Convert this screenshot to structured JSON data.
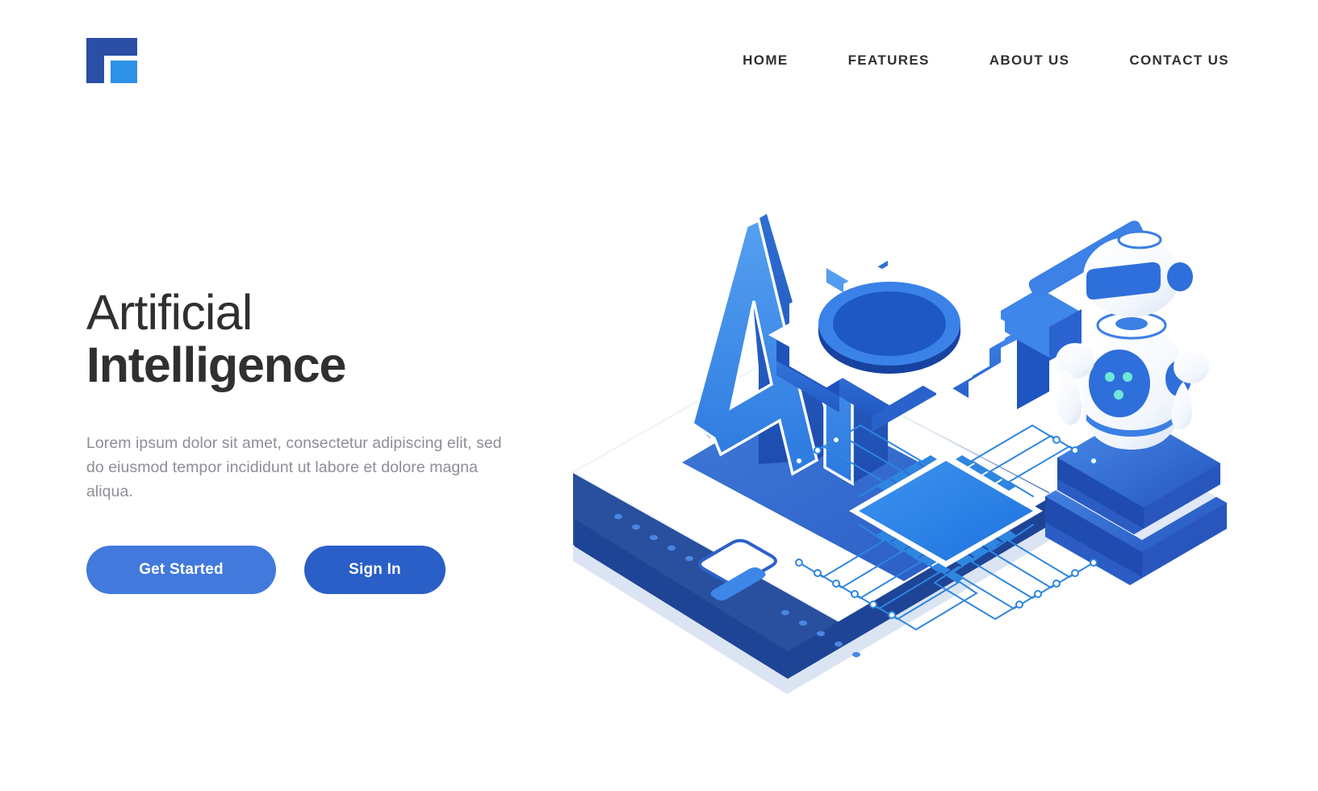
{
  "header": {
    "logo_name": "company-logo",
    "nav": [
      {
        "label": "HOME"
      },
      {
        "label": "FEATURES"
      },
      {
        "label": "ABOUT US"
      },
      {
        "label": "CONTACT US"
      }
    ]
  },
  "hero": {
    "headline_line1": "Artificial",
    "headline_line2": "Intelligence",
    "description": "Lorem ipsum dolor sit amet, consectetur adipiscing elit, sed do eiusmod tempor incididunt ut labore et dolore magna aliqua.",
    "primary_button": "Get Started",
    "secondary_button": "Sign In"
  },
  "illustration": {
    "alt": "isometric-ai-smartphone-robot-gear-chip",
    "text_3d": "AI",
    "elements": [
      "smartphone",
      "ai-letters",
      "gear",
      "robot",
      "platform-stack",
      "cpu-chip",
      "circuit-traces",
      "arrow"
    ]
  },
  "colors": {
    "background": "#ffffff",
    "heading": "#303033",
    "body_text": "#8d8f96",
    "nav_text": "#2f3033",
    "primary_button": "#4279dc",
    "secondary_button": "#2a5fc8",
    "logo_dark": "#2a4fa4",
    "logo_light": "#2e92e8",
    "illustration_blue": "#2f7fe5",
    "illustration_deep_blue": "#1f4fbc",
    "illustration_light": "#eef3fb"
  }
}
